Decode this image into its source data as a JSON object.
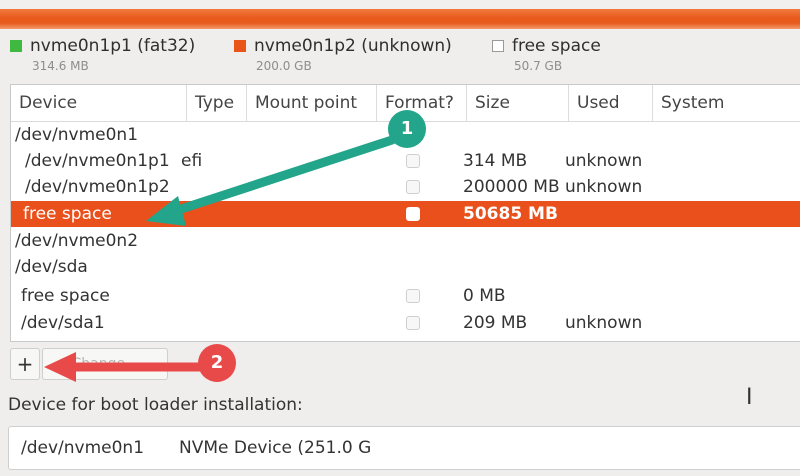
{
  "legend": [
    {
      "name": "nvme0n1p1 (fat32)",
      "size": "314.6 MB",
      "color": "#3fb93f"
    },
    {
      "name": "nvme0n1p2 (unknown)",
      "size": "200.0 GB",
      "color": "#e9541b"
    },
    {
      "name": "free space",
      "size": "50.7 GB",
      "color": "#ffffff"
    }
  ],
  "table": {
    "columns": [
      "Device",
      "Type",
      "Mount point",
      "Format?",
      "Size",
      "Used",
      "System"
    ],
    "rows": [
      {
        "device": "/dev/nvme0n1",
        "type": "",
        "size": "",
        "used": "",
        "checkbox": false
      },
      {
        "device": "/dev/nvme0n1p1",
        "type": "efi",
        "size": "314 MB",
        "used": "unknown",
        "checkbox": true
      },
      {
        "device": "/dev/nvme0n1p2",
        "type": "",
        "size": "200000 MB",
        "used": "unknown",
        "checkbox": true
      },
      {
        "device": "free space",
        "type": "",
        "size": "50685 MB",
        "used": "",
        "checkbox": true,
        "selected": true
      },
      {
        "device": "/dev/nvme0n2",
        "type": "",
        "size": "",
        "used": "",
        "checkbox": false
      },
      {
        "device": "/dev/sda",
        "type": "",
        "size": "",
        "used": "",
        "checkbox": false
      },
      {
        "device": "free space",
        "type": "",
        "size": "0 MB",
        "used": "",
        "checkbox": true
      },
      {
        "device": "/dev/sda1",
        "type": "",
        "size": "209 MB",
        "used": "unknown",
        "checkbox": true
      }
    ]
  },
  "toolbar": {
    "add_label": "+",
    "change_label": "Change..."
  },
  "boot_loader": {
    "label": "Device for boot loader installation:",
    "device": "/dev/nvme0n1",
    "description": "NVMe Device (251.0 G"
  },
  "annotations": {
    "badge1": "1",
    "badge2": "2",
    "arrow1_color": "#22a58a",
    "arrow2_color": "#e84a4a"
  },
  "cursor_glyph": "I"
}
